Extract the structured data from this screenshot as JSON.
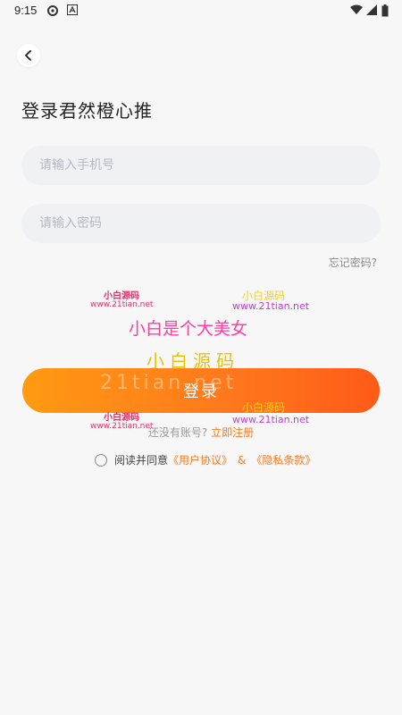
{
  "status_bar": {
    "time": "9:15",
    "icons": [
      "sync-icon",
      "font-icon",
      "wifi-icon",
      "signal-icon",
      "battery-icon"
    ]
  },
  "nav": {
    "back_icon": "chevron-left-icon"
  },
  "page": {
    "title": "登录君然橙心推"
  },
  "form": {
    "phone_placeholder": "请输入手机号",
    "password_placeholder": "请输入密码",
    "forgot_label": "忘记密码?",
    "login_label": "登录"
  },
  "register": {
    "prompt": "还没有账号?",
    "link": "立即注册"
  },
  "agreement": {
    "prefix": "阅读并同意",
    "user_agreement": "《用户协议》",
    "amp": "&",
    "privacy": "《隐私条款》"
  },
  "watermark": {
    "brand_small": "小白源码",
    "site": "www.21tian.net",
    "slogan": "小白是个大美女",
    "brand_big": "小白源码",
    "faint": "21tian.net"
  },
  "colors": {
    "accent": "#ff7a1c",
    "gradient_start": "#ff9a12",
    "gradient_end": "#ff5a18",
    "background": "#f7f7f8",
    "input_bg": "#f0f1f5"
  }
}
